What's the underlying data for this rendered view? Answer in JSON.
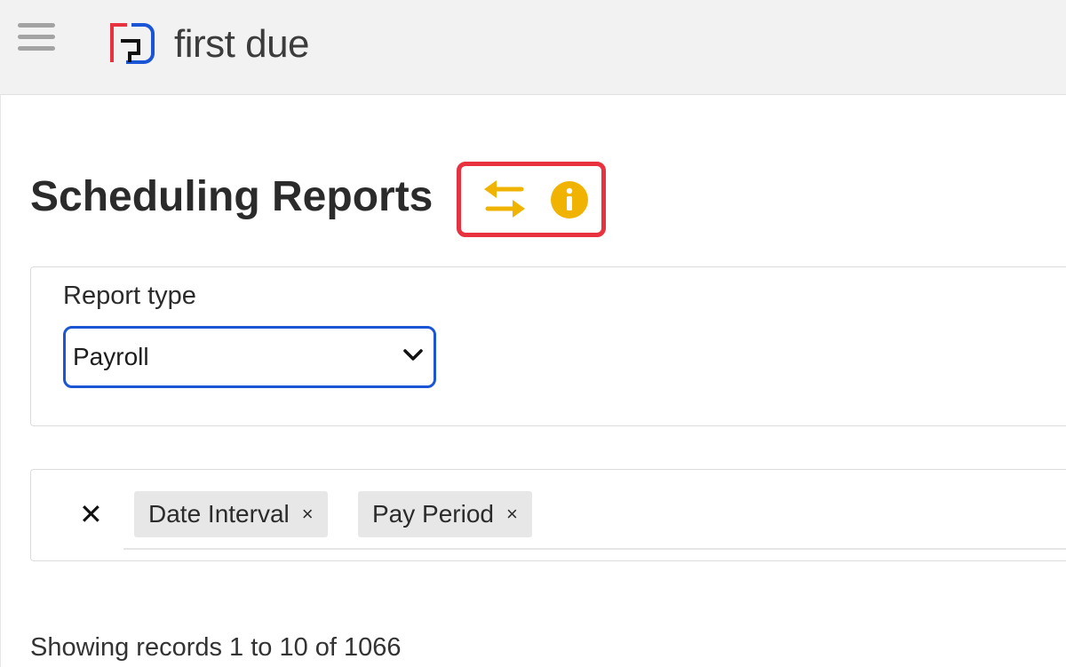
{
  "header": {
    "menu_icon": "hamburger-icon",
    "logo_icon": "first-due-logo",
    "logo_text": "first due"
  },
  "page": {
    "title": "Scheduling Reports",
    "actions": {
      "swap_icon": "swap-arrows-icon",
      "info_icon": "info-icon",
      "highlight_color": "#e8323f",
      "icon_color": "#f0b400"
    }
  },
  "filters": {
    "report_type_label": "Report type",
    "report_type_value": "Payroll",
    "options": [
      "Payroll"
    ]
  },
  "active_filters": {
    "clear_all_icon": "close-icon",
    "tags": [
      {
        "label": "Date Interval",
        "remove": "×"
      },
      {
        "label": "Pay Period",
        "remove": "×"
      }
    ]
  },
  "table": {
    "records_info": "Showing records 1 to 10 of 1066"
  },
  "colors": {
    "select_border": "#1a55d6",
    "logo_red": "#e8323f",
    "logo_blue": "#1a55d6"
  }
}
